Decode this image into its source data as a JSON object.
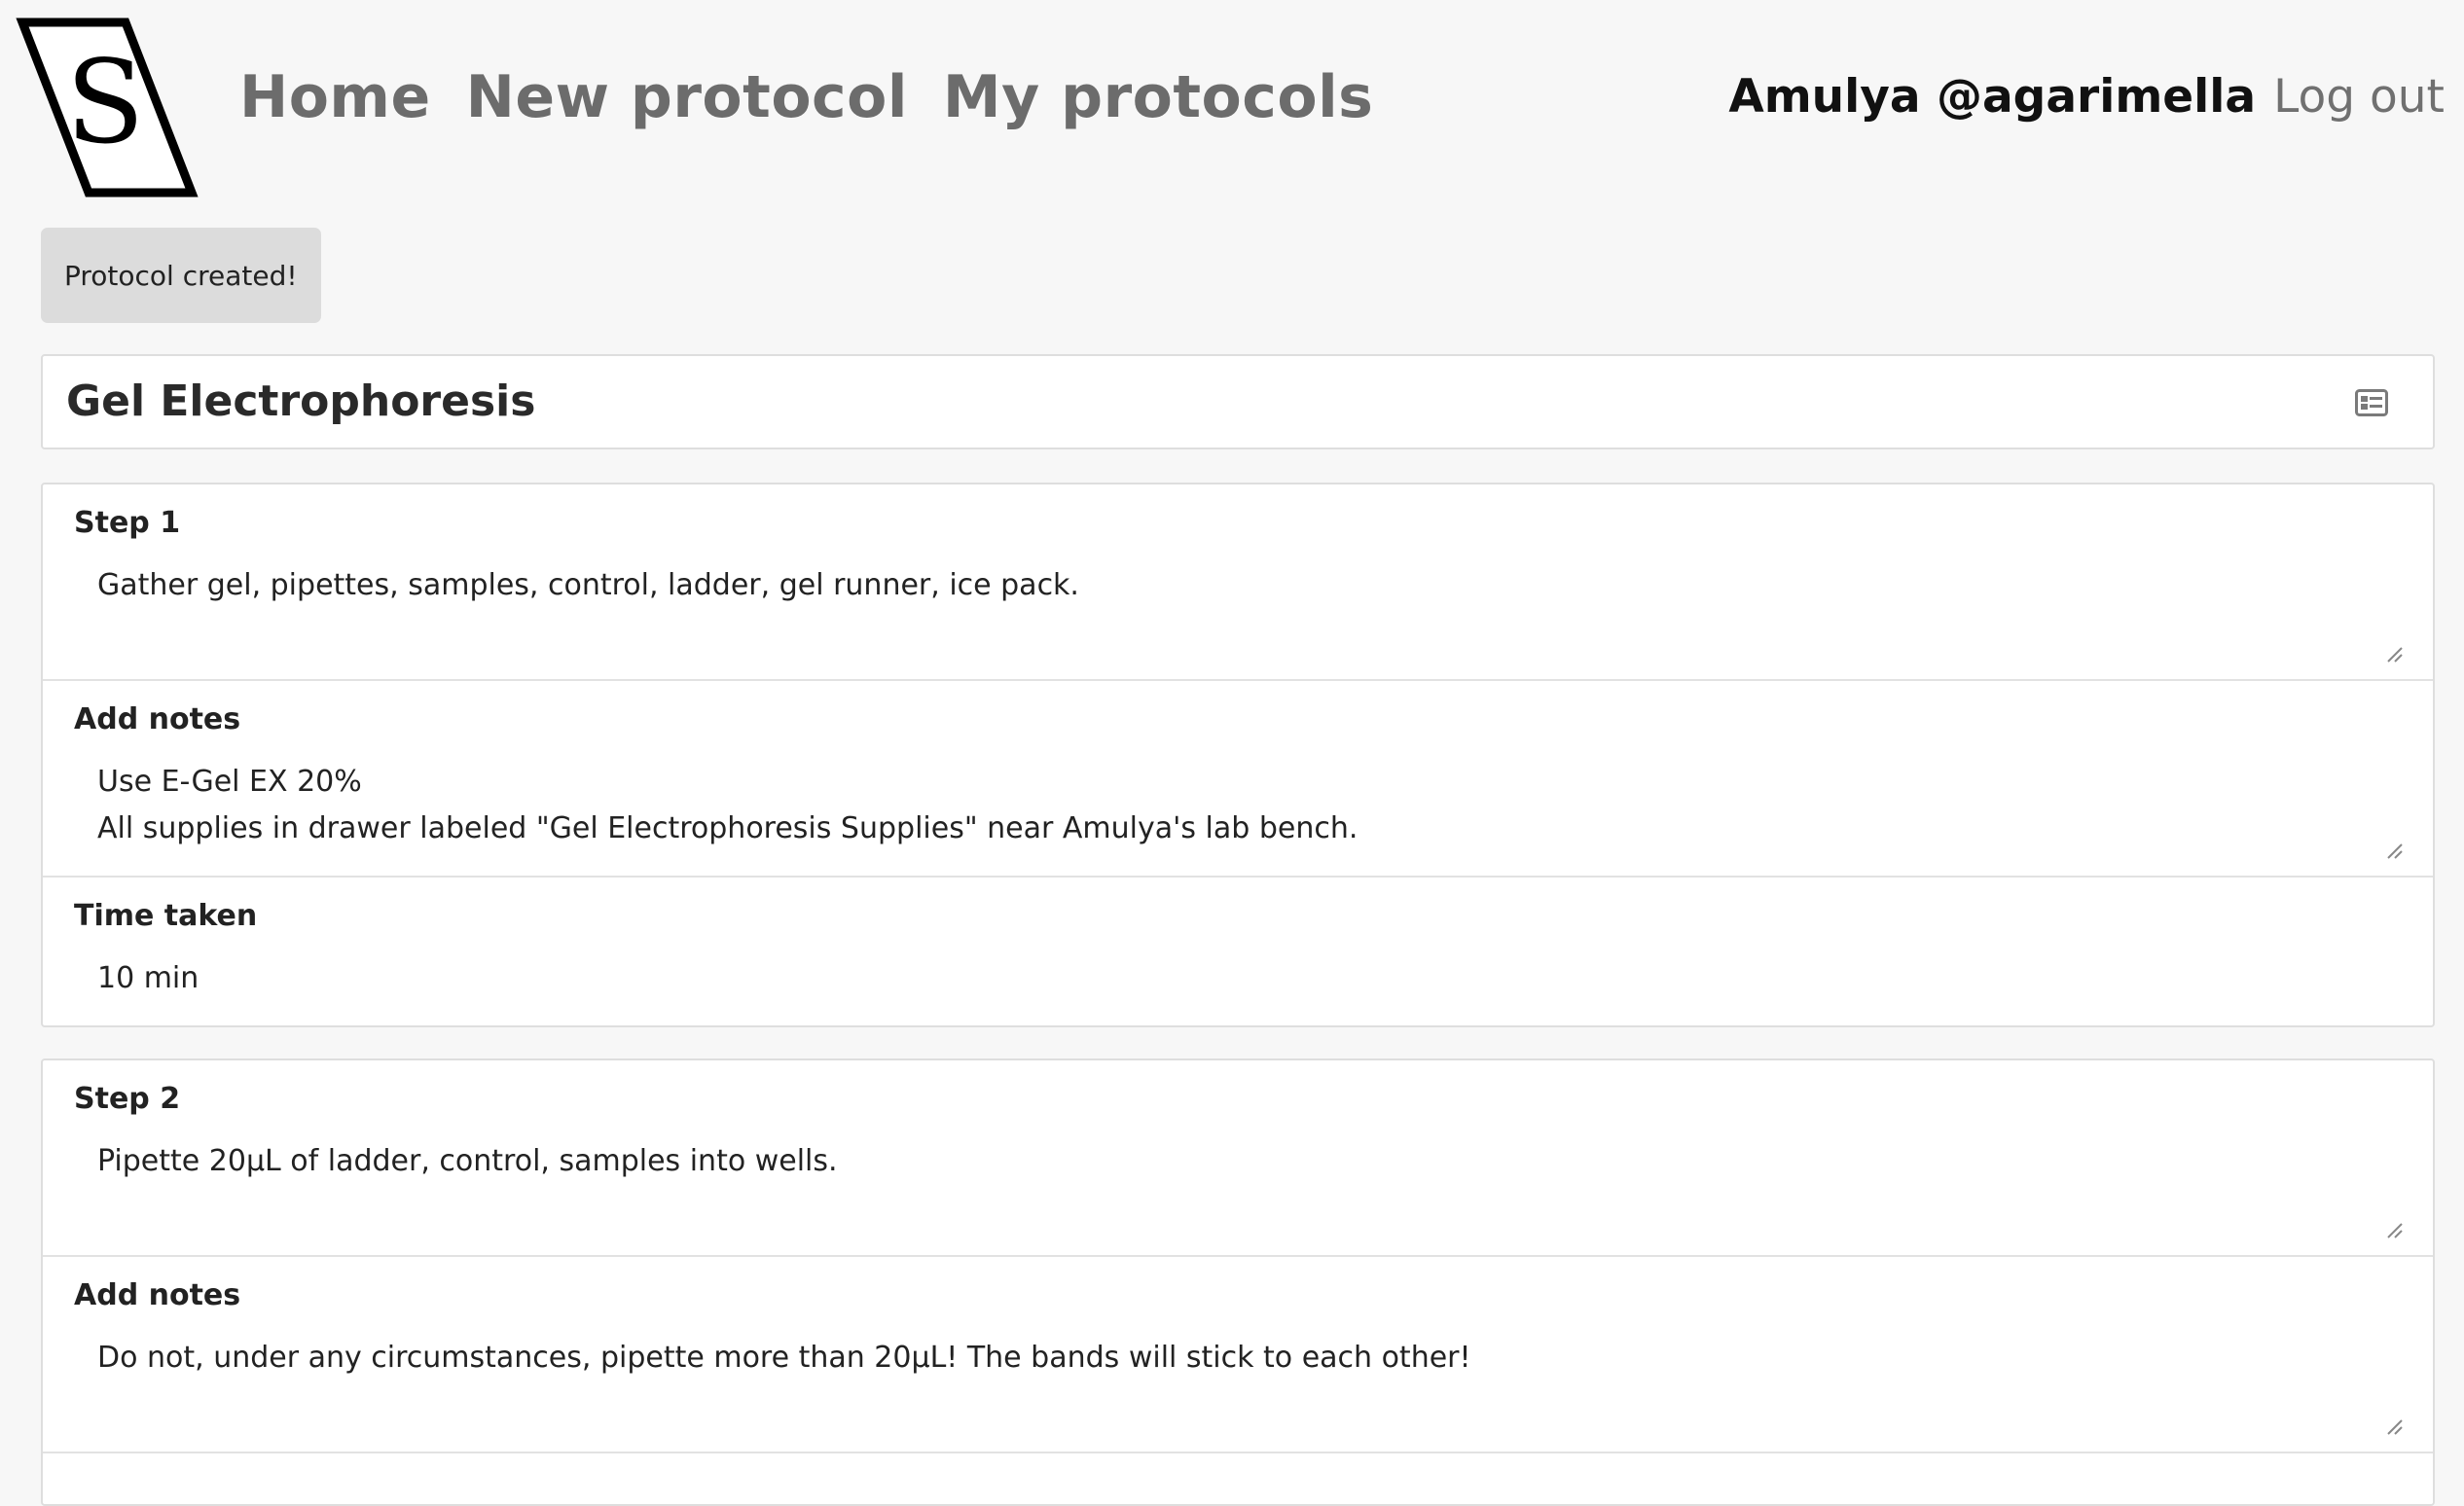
{
  "brand": {
    "logo_letter": "S"
  },
  "nav": {
    "home": "Home",
    "new_protocol": "New protocol",
    "my_protocols": "My protocols"
  },
  "user": {
    "display": "Amulya @agarimella",
    "logout": "Log out"
  },
  "flash": {
    "message": "Protocol created!"
  },
  "protocol": {
    "title": "Gel Electrophoresis",
    "title_icon": "id-card-icon"
  },
  "steps": [
    {
      "label": "Step 1",
      "text": "Gather gel, pipettes, samples, control, ladder, gel runner, ice pack.",
      "notes_label": "Add notes",
      "notes": "Use E-Gel EX 20%\nAll supplies in drawer labeled \"Gel Electrophoresis Supplies\" near Amulya's lab bench.",
      "time_label": "Time taken",
      "time": "10 min"
    },
    {
      "label": "Step 2",
      "text": "Pipette 20µL of ladder, control, samples into wells.",
      "notes_label": "Add notes",
      "notes": "Do not, under any circumstances, pipette more than 20µL! The bands will stick to each other!"
    }
  ]
}
